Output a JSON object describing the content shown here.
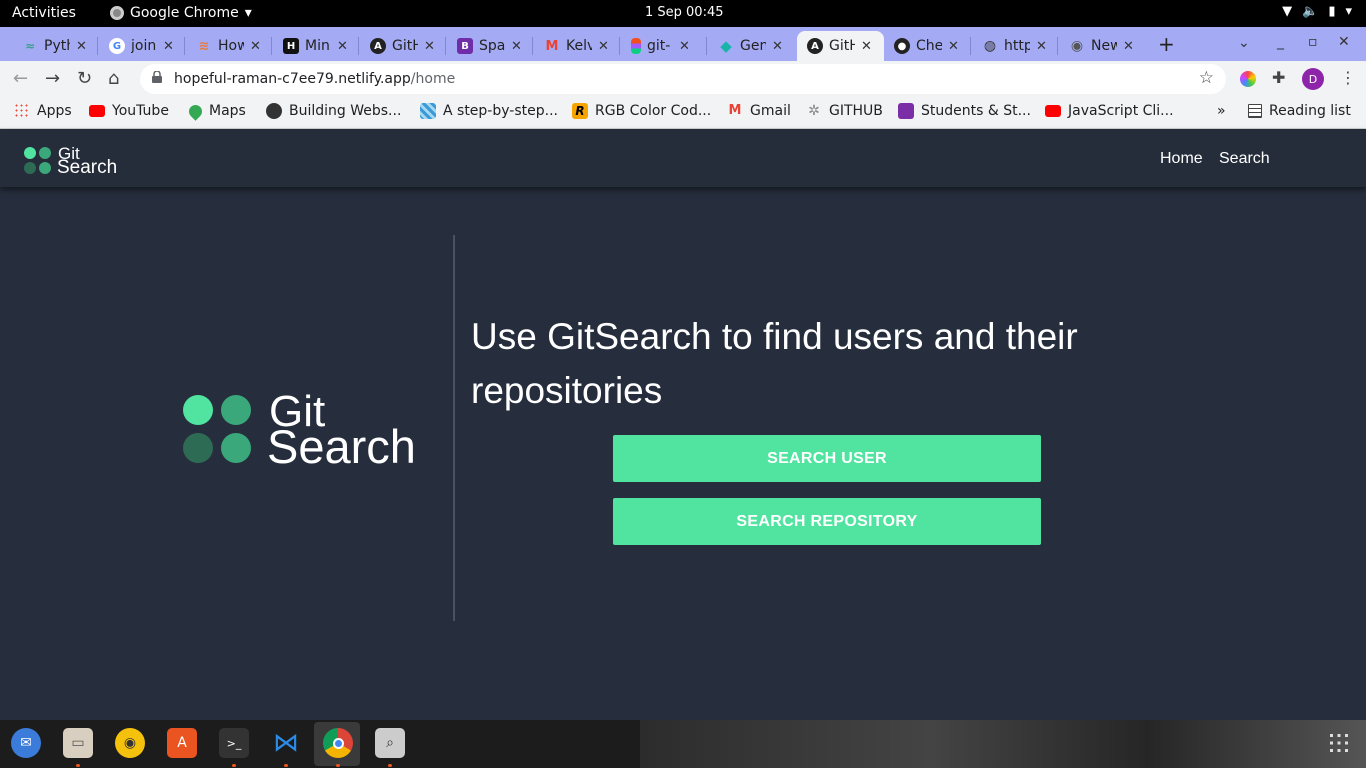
{
  "system": {
    "activities": "Activities",
    "app_name": "Google Chrome",
    "clock": "1 Sep  00:45"
  },
  "tabs": [
    {
      "label": "Pyth",
      "icon": "python-icon",
      "color": "#3b9e8f"
    },
    {
      "label": "join",
      "icon": "google-icon",
      "color": "#ffffff"
    },
    {
      "label": "How",
      "icon": "stack-icon",
      "color": "#e87d3e"
    },
    {
      "label": "Min",
      "icon": "hackerrank-icon",
      "color": "#111111"
    },
    {
      "label": "GitH",
      "icon": "angular-icon",
      "color": "#222222"
    },
    {
      "label": "Spa",
      "icon": "bootstrap-icon",
      "color": "#6f2da8"
    },
    {
      "label": "Kelv",
      "icon": "gmail-icon",
      "color": "#ffffff"
    },
    {
      "label": "git-",
      "icon": "figma-icon",
      "color": "#ffffff"
    },
    {
      "label": "Gen",
      "icon": "diamond-icon",
      "color": "#18b4a9"
    },
    {
      "label": "GitH",
      "icon": "angular-icon",
      "color": "#222222",
      "active": true
    },
    {
      "label": "Che",
      "icon": "github-icon",
      "color": "#222222"
    },
    {
      "label": "http",
      "icon": "globe-icon",
      "color": "#444444"
    },
    {
      "label": "New",
      "icon": "chrome-icon",
      "color": "#666666"
    }
  ],
  "address": {
    "host": "hopeful-raman-c7ee79.netlify.app",
    "path": "/home"
  },
  "profile_initial": "D",
  "bookmarks": [
    {
      "label": "Apps",
      "icon": "apps-grid-icon",
      "color": "#4285f4"
    },
    {
      "label": "YouTube",
      "icon": "youtube-icon",
      "color": "#ff0000"
    },
    {
      "label": "Maps",
      "icon": "maps-pin-icon",
      "color": "#34a853"
    },
    {
      "label": "Building Webs...",
      "icon": "globe-icon",
      "color": "#333333"
    },
    {
      "label": "A step-by-step...",
      "icon": "pattern-icon",
      "color": "#3a9bd8"
    },
    {
      "label": "RGB Color Cod...",
      "icon": "rapidtables-icon",
      "color": "#f5a400"
    },
    {
      "label": "Gmail",
      "icon": "gmail-icon",
      "color": "#ea4335"
    },
    {
      "label": "GITHUB",
      "icon": "github-bookmark-icon",
      "color": "#888888"
    },
    {
      "label": "Students & St...",
      "icon": "list-icon",
      "color": "#7b2fa6"
    },
    {
      "label": "JavaScript Cli...",
      "icon": "youtube-icon",
      "color": "#ff0000"
    }
  ],
  "bookmarks_overflow": "»",
  "reading_list": "Reading list",
  "site": {
    "logo_word1": "Git",
    "logo_word2": "Search",
    "nav_home": "Home",
    "nav_search": "Search",
    "headline": "Use GitSearch to find users and their repositories",
    "btn_user": "SEARCH USER",
    "btn_repo": "SEARCH REPOSITORY"
  },
  "colors": {
    "accent": "#50e4a0",
    "dot_light": "#50e4a0",
    "dot_mid": "#3aa87a",
    "dot_dark": "#2e6b55",
    "page_bg": "#262e3d"
  },
  "dock": [
    "thunderbird-icon",
    "files-icon",
    "rhythmbox-icon",
    "software-icon",
    "terminal-icon",
    "vscode-icon",
    "chrome-icon",
    "screenshot-icon",
    "show-apps-icon"
  ]
}
